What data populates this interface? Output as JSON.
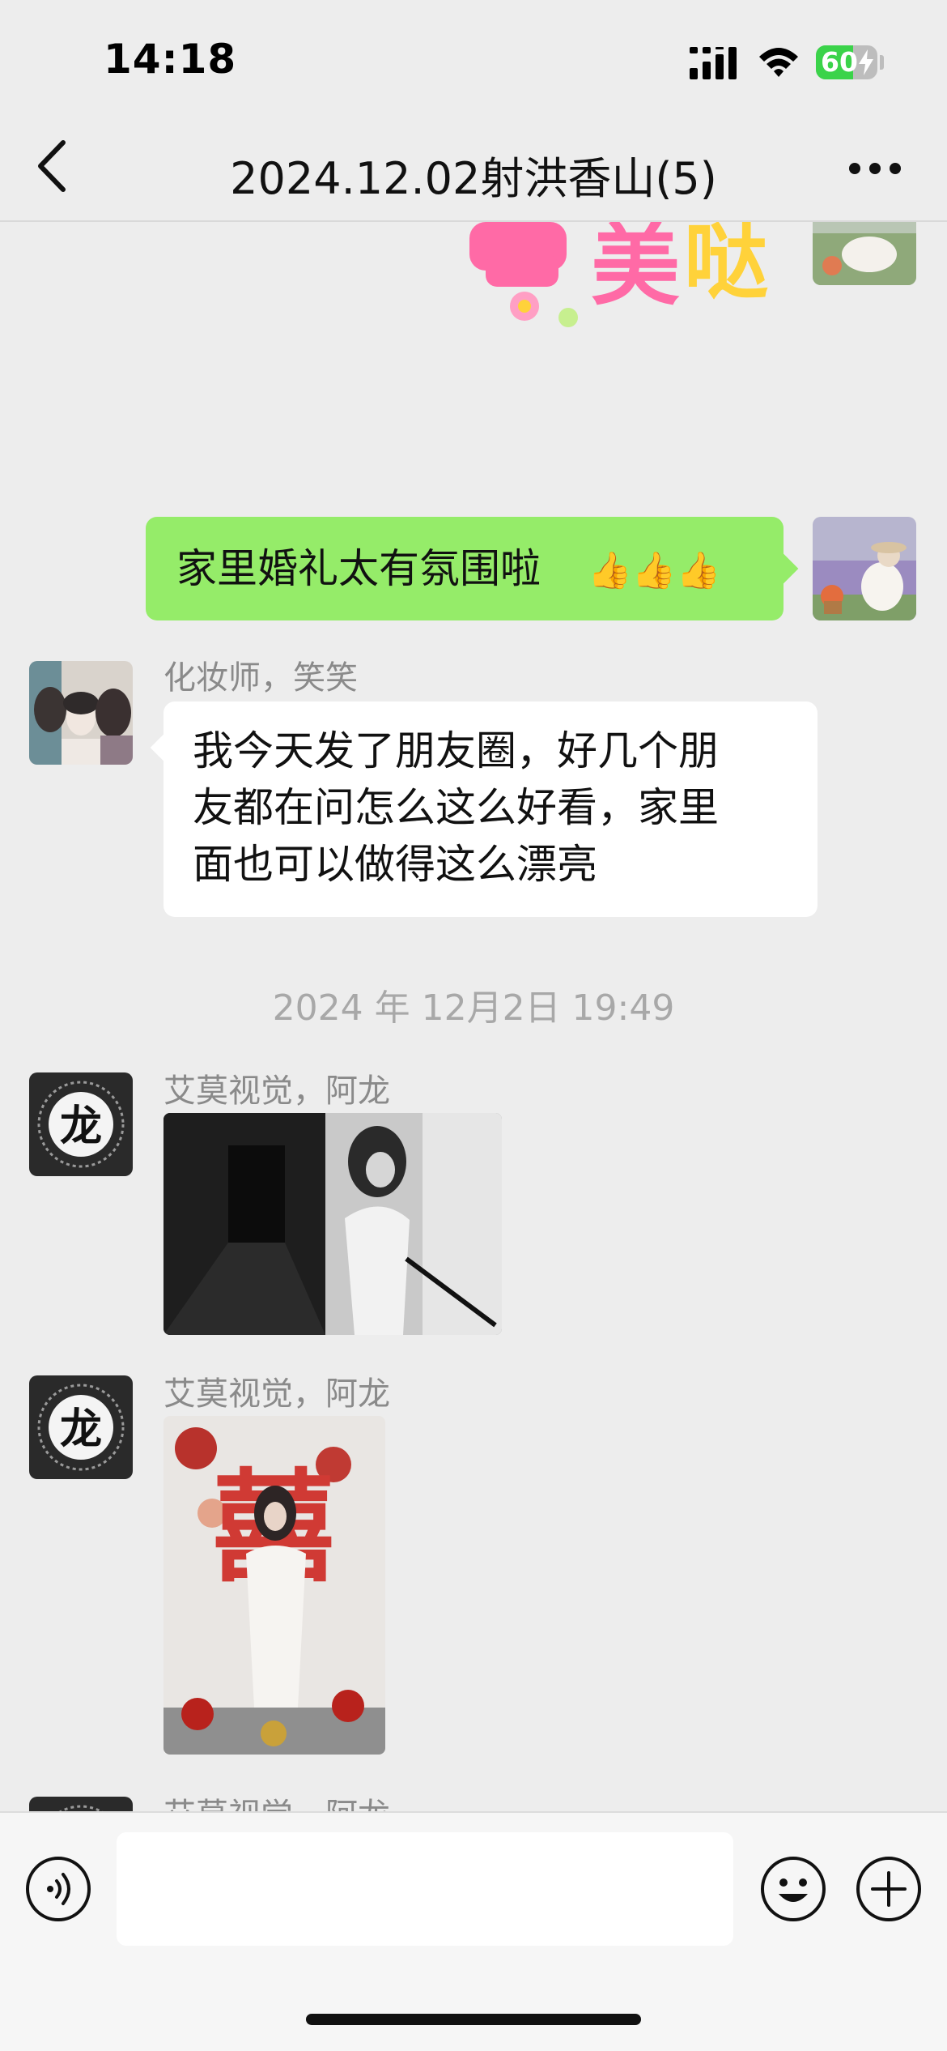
{
  "status_bar": {
    "time": "14:18",
    "battery_percent": "60",
    "battery_level": 0.6,
    "icons": [
      "signal-icon",
      "wifi-icon",
      "battery-icon",
      "charging-bolt-icon"
    ]
  },
  "nav": {
    "title": "2024.12.02射洪香山(5)",
    "back_icon": "chevron-left-icon",
    "more_icon": "ellipsis-icon"
  },
  "sticker": {
    "text": "美哒",
    "colors": [
      "#ff6aa6",
      "#ffd23a"
    ]
  },
  "messages": [
    {
      "type": "text",
      "outgoing": true,
      "text": "家里婚礼太有氛围啦",
      "emoji": "👍👍👍"
    },
    {
      "type": "text",
      "outgoing": false,
      "sender": "化妆师，笑笑",
      "text_lines": [
        "我今天发了朋友圈，好几个朋",
        "友都在问怎么这么好看，家里",
        "面也可以做得这么漂亮"
      ]
    },
    {
      "type": "timestamp",
      "text": "2024 年 12月2日 19:49"
    },
    {
      "type": "image",
      "outgoing": false,
      "sender": "艾莫视觉，阿龙",
      "avatar_glyph": "龙"
    },
    {
      "type": "image",
      "outgoing": false,
      "sender": "艾莫视觉，阿龙",
      "avatar_glyph": "龙",
      "photo_glyph": "囍"
    },
    {
      "type": "image",
      "outgoing": false,
      "sender": "艾莫视觉，阿龙",
      "avatar_glyph": "龙"
    }
  ],
  "input_bar": {
    "value": "",
    "icons": [
      "voice-icon",
      "emoji-icon",
      "plus-icon"
    ]
  },
  "colors": {
    "background": "#ededed",
    "outgoing_bubble": "#95ec69",
    "incoming_bubble": "#ffffff"
  }
}
